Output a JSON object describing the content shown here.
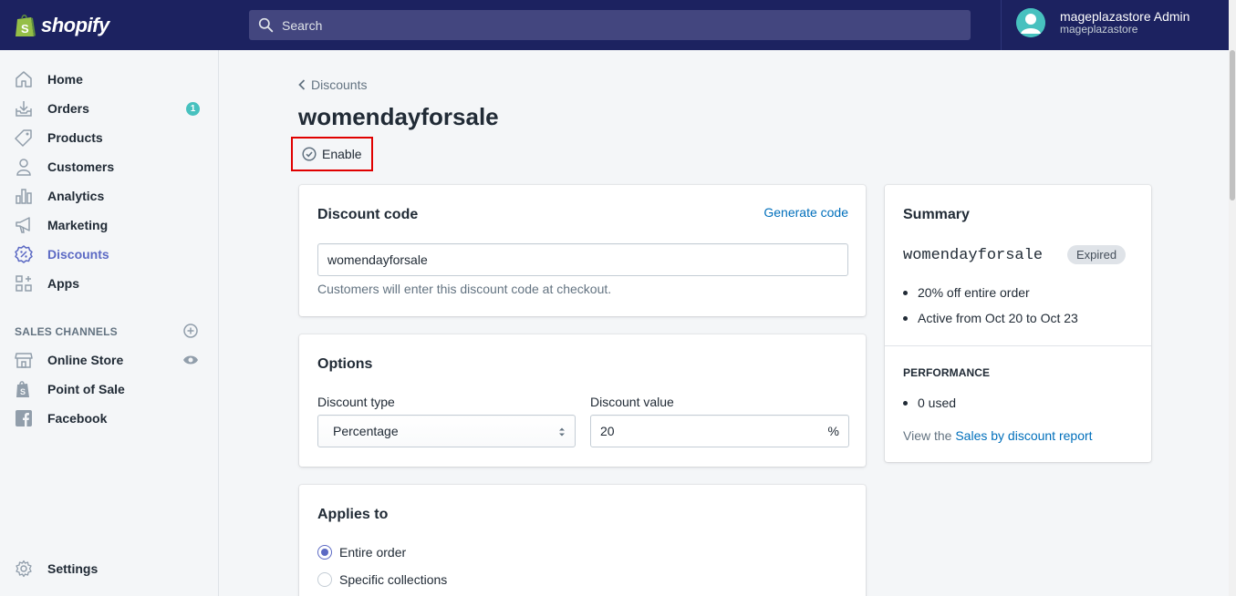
{
  "header": {
    "brand": "shopify",
    "search_placeholder": "Search",
    "user_name": "mageplazastore Admin",
    "store_name": "mageplazastore"
  },
  "sidebar": {
    "items": [
      {
        "label": "Home",
        "icon": "home-icon"
      },
      {
        "label": "Orders",
        "icon": "orders-icon",
        "badge": "1"
      },
      {
        "label": "Products",
        "icon": "tag-icon"
      },
      {
        "label": "Customers",
        "icon": "person-icon"
      },
      {
        "label": "Analytics",
        "icon": "bar-chart-icon"
      },
      {
        "label": "Marketing",
        "icon": "megaphone-icon"
      },
      {
        "label": "Discounts",
        "icon": "discount-icon",
        "active": true
      },
      {
        "label": "Apps",
        "icon": "apps-icon"
      }
    ],
    "sales_channels_title": "SALES CHANNELS",
    "channels": [
      {
        "label": "Online Store",
        "icon": "store-icon"
      },
      {
        "label": "Point of Sale",
        "icon": "shopify-bag-icon"
      },
      {
        "label": "Facebook",
        "icon": "facebook-icon"
      }
    ],
    "settings_label": "Settings"
  },
  "page": {
    "breadcrumb": "Discounts",
    "title": "womendayforsale",
    "enable_label": "Enable"
  },
  "discount_code_card": {
    "title": "Discount code",
    "generate_link": "Generate code",
    "code_value": "womendayforsale",
    "help_text": "Customers will enter this discount code at checkout."
  },
  "options_card": {
    "title": "Options",
    "type_label": "Discount type",
    "type_value": "Percentage",
    "value_label": "Discount value",
    "value_value": "20",
    "value_suffix": "%"
  },
  "applies_card": {
    "title": "Applies to",
    "options": [
      "Entire order",
      "Specific collections"
    ],
    "selected": "Entire order"
  },
  "summary_card": {
    "title": "Summary",
    "code": "womendayforsale",
    "status": "Expired",
    "details": [
      "20% off entire order",
      "Active from Oct 20 to Oct 23"
    ],
    "performance_title": "PERFORMANCE",
    "performance_items": [
      "0 used"
    ],
    "report_prefix": "View the",
    "report_link": "Sales by discount report"
  },
  "colors": {
    "topbar": "#1c2260",
    "accent": "#5c6ac4",
    "link": "#006fbb",
    "badge": "#47c1bf",
    "highlight_box": "#e00000"
  }
}
